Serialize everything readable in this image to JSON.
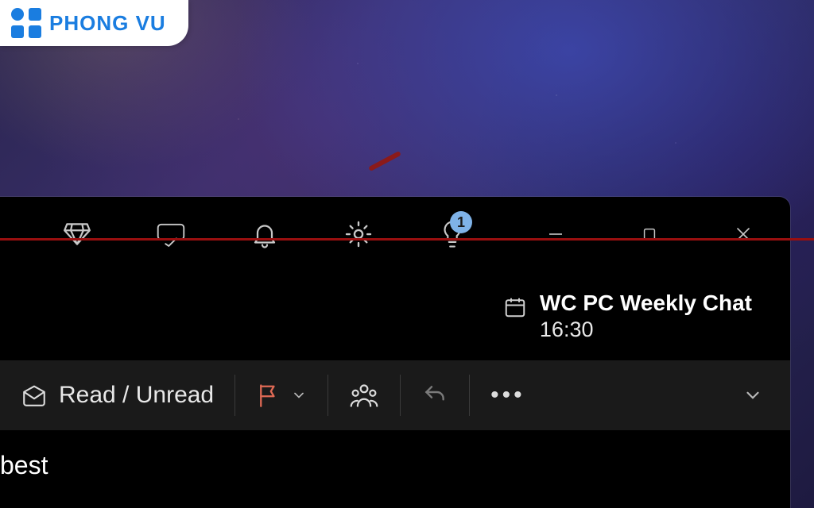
{
  "watermark": {
    "brand": "PHONG VU"
  },
  "titlebar": {
    "icons": [
      "premium-icon",
      "onedrive-check-icon",
      "bell-icon",
      "settings-icon",
      "lightbulb-icon"
    ],
    "notification_badge": "1",
    "window_controls": [
      "minimize",
      "maximize",
      "close"
    ]
  },
  "annotation": {
    "highlight_line": true
  },
  "calendar_event": {
    "title": "WC PC Weekly Chat",
    "time": "16:30"
  },
  "actionbar": {
    "read_unread_label": "Read / Unread",
    "flag_label": "Flag",
    "team_label": "Team",
    "undo_label": "Undo",
    "more_label": "•••"
  },
  "content": {
    "visible_snippet": "best"
  },
  "colors": {
    "badge_bg": "#7fb3e8",
    "flag": "#e06a55",
    "annotation_line": "#9a0f0f",
    "brand": "#1a7de0"
  }
}
